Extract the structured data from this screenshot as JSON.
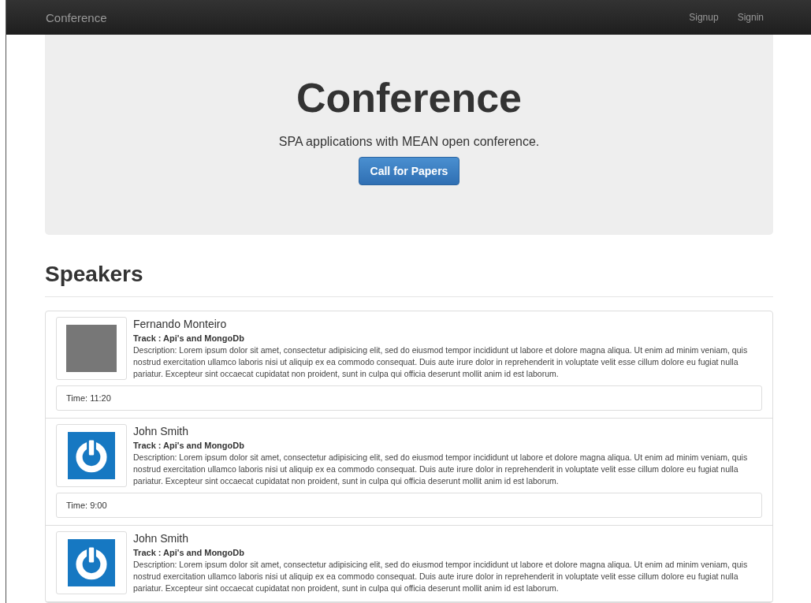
{
  "navbar": {
    "brand": "Conference",
    "links": [
      "Signup",
      "Signin"
    ]
  },
  "hero": {
    "title": "Conference",
    "subtitle": "SPA applications with MEAN open conference.",
    "button": "Call for Papers"
  },
  "section": {
    "title": "Speakers"
  },
  "speakers": [
    {
      "kind": "photo",
      "name": "Fernando Monteiro",
      "track": "Track : Api's and MongoDb",
      "description": "Description: Lorem ipsum dolor sit amet, consectetur adipisicing elit, sed do eiusmod tempor incididunt ut labore et dolore magna aliqua. Ut enim ad minim veniam, quis nostrud exercitation ullamco laboris nisi ut aliquip ex ea commodo consequat. Duis aute irure dolor in reprehenderit in voluptate velit esse cillum dolore eu fugiat nulla pariatur. Excepteur sint occaecat cupidatat non proident, sunt in culpa qui officia deserunt mollit anim id est laborum.",
      "time": "Time: 11:20"
    },
    {
      "kind": "logo",
      "name": "John Smith",
      "track": "Track : Api's and MongoDb",
      "description": "Description: Lorem ipsum dolor sit amet, consectetur adipisicing elit, sed do eiusmod tempor incididunt ut labore et dolore magna aliqua. Ut enim ad minim veniam, quis nostrud exercitation ullamco laboris nisi ut aliquip ex ea commodo consequat. Duis aute irure dolor in reprehenderit in voluptate velit esse cillum dolore eu fugiat nulla pariatur. Excepteur sint occaecat cupidatat non proident, sunt in culpa qui officia deserunt mollit anim id est laborum.",
      "time": "Time: 9:00"
    },
    {
      "kind": "logo",
      "name": "John Smith",
      "track": "Track : Api's and MongoDb",
      "description": "Description: Lorem ipsum dolor sit amet, consectetur adipisicing elit, sed do eiusmod tempor incididunt ut labore et dolore magna aliqua. Ut enim ad minim veniam, quis nostrud exercitation ullamco laboris nisi ut aliquip ex ea commodo consequat. Duis aute irure dolor in reprehenderit in voluptate velit esse cillum dolore eu fugiat nulla pariatur. Excepteur sint occaecat cupidatat non proident, sunt in culpa qui officia deserunt mollit anim id est laborum."
    }
  ]
}
